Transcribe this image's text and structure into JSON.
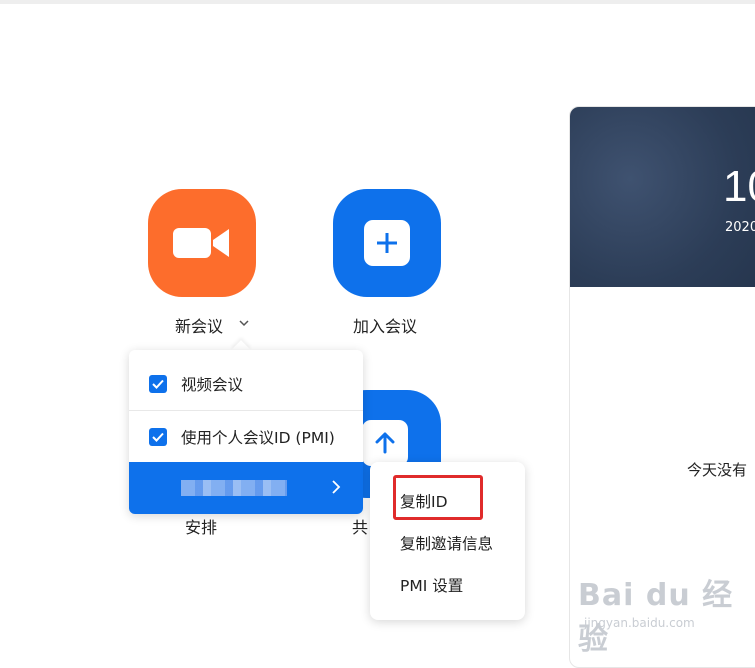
{
  "tiles": {
    "new_meeting": {
      "label": "新会议",
      "icon": "video-camera-icon",
      "color": "#fd6d2c"
    },
    "join_meeting": {
      "label": "加入会议",
      "icon": "plus-icon",
      "color": "#0e71eb"
    },
    "share_screen": {
      "label_partial": "共",
      "icon": "arrow-up-icon",
      "color": "#0e71eb"
    },
    "schedule": {
      "label_partial": "安排"
    }
  },
  "calendar": {
    "time_partial": "10",
    "date_partial": "2020",
    "empty_text_partial": "今天没有"
  },
  "dropdown": {
    "items": [
      {
        "label": "视频会议",
        "checked": true
      },
      {
        "label": "使用个人会议ID (PMI)",
        "checked": true
      }
    ],
    "active_item": {
      "label_obscured": true,
      "has_submenu": true
    }
  },
  "submenu": {
    "items": [
      "复制ID",
      "复制邀请信息",
      "PMI 设置"
    ]
  },
  "watermark": {
    "brand": "Bai du 经验",
    "url": "jingyan.baidu.com"
  },
  "colors": {
    "accent": "#0e71eb",
    "orange": "#fd6d2c",
    "highlight": "#e02b2b"
  }
}
